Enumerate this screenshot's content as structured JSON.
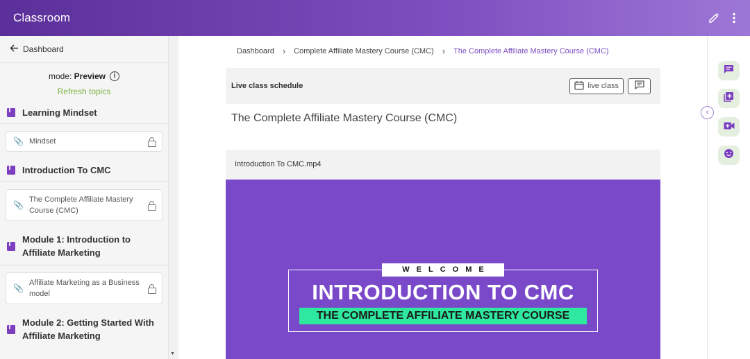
{
  "header": {
    "title": "Classroom"
  },
  "sidebar": {
    "back_label": "Dashboard",
    "mode_label": "mode:",
    "mode_value": "Preview",
    "refresh_label": "Refresh topics",
    "items": [
      {
        "type": "section",
        "label": "Learning Mindset"
      },
      {
        "type": "lesson",
        "label": "Mindset"
      },
      {
        "type": "section",
        "label": "Introduction To CMC"
      },
      {
        "type": "lesson",
        "label": "The Complete Affiliate Mastery Course (CMC)"
      },
      {
        "type": "section",
        "label": "Module 1: Introduction to Affiliate Marketing"
      },
      {
        "type": "lesson",
        "label": "Affiliate Marketing as a Business model"
      },
      {
        "type": "section",
        "label": "Module 2: Getting Started With Affiliate Marketing"
      }
    ]
  },
  "breadcrumb": {
    "items": [
      "Dashboard",
      "Complete Affiliate Mastery Course (CMC)",
      "The Complete Affiliate Mastery Course (CMC)"
    ]
  },
  "schedule": {
    "label": "Live class schedule",
    "live_class_button": "live class"
  },
  "main": {
    "course_title": "The Complete Affiliate Mastery Course (CMC)",
    "video_filename": "Introduction To CMC.mp4",
    "video_welcome": "WELCOME",
    "video_title": "INTRODUCTION TO CMC",
    "video_subtitle": "THE COMPLETE AFFILIATE MASTERY COURSE"
  },
  "right_rail": {
    "buttons": [
      "chat-icon",
      "add-note-icon",
      "video-call-icon",
      "emoji-icon"
    ]
  },
  "colors": {
    "brand": "#7a49c9",
    "accent_green": "#7cb342",
    "video_band": "#2ee89f"
  }
}
